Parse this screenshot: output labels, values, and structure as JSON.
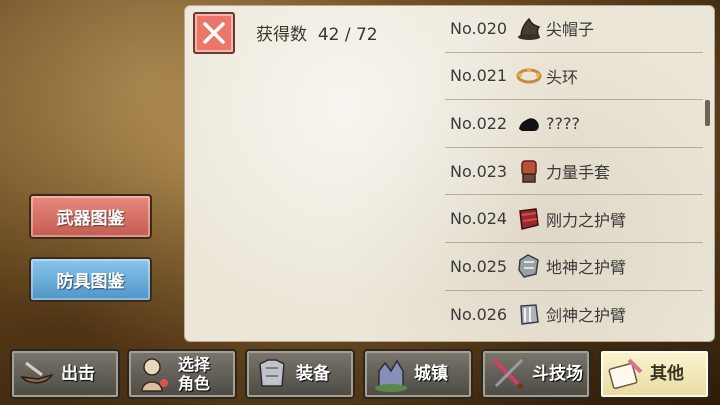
{
  "sidebar": {
    "weapon_label": "武器图鉴",
    "armor_label": "防具图鉴"
  },
  "collection": {
    "count_label": "获得数",
    "count_value": "42 / 72"
  },
  "items": [
    {
      "no": "No.020",
      "name": "尖帽子",
      "icon": "pointed-hat-icon",
      "color": "#4a3b32"
    },
    {
      "no": "No.021",
      "name": "头环",
      "icon": "circlet-icon",
      "color": "#c98a3a"
    },
    {
      "no": "No.022",
      "name": "????",
      "icon": "unknown-silhouette-icon",
      "color": "#111111"
    },
    {
      "no": "No.023",
      "name": "力量手套",
      "icon": "power-glove-icon",
      "color": "#b8503a"
    },
    {
      "no": "No.024",
      "name": "刚力之护臂",
      "icon": "strength-bracer-icon",
      "color": "#9a2a2a"
    },
    {
      "no": "No.025",
      "name": "地神之护臂",
      "icon": "earth-god-bracer-icon",
      "color": "#9aa0a8"
    },
    {
      "no": "No.026",
      "name": "剑神之护臂",
      "icon": "sword-god-bracer-icon",
      "color": "#aeb4bc"
    }
  ],
  "tabs": [
    {
      "label": "出击",
      "icon": "ship-icon"
    },
    {
      "label1": "选择",
      "label2": "角色",
      "icon": "character-icon"
    },
    {
      "label": "装备",
      "icon": "armor-icon"
    },
    {
      "label": "城镇",
      "icon": "castle-icon"
    },
    {
      "label": "斗技场",
      "icon": "crossed-swords-icon"
    },
    {
      "label": "其他",
      "icon": "scroll-quill-icon",
      "active": true
    }
  ]
}
